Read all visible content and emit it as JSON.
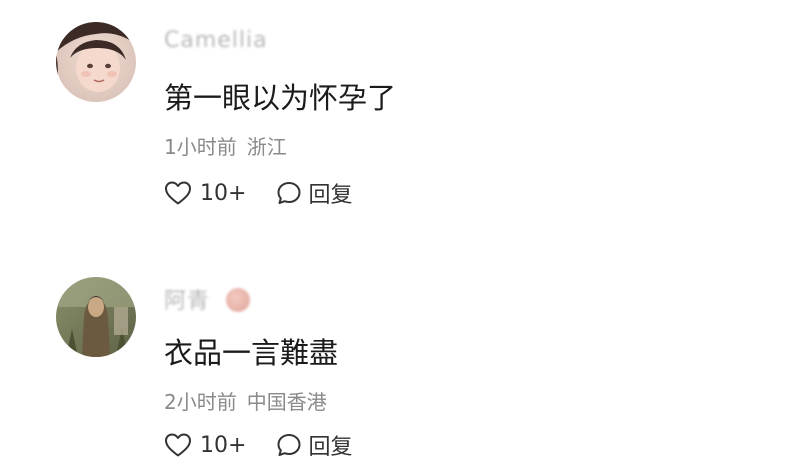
{
  "comments": [
    {
      "username": "Camellia",
      "content": "第一眼以为怀孕了",
      "time": "1小时前",
      "location": "浙江",
      "like_count": "10+",
      "reply_label": "回复",
      "like_icon": "heart-icon",
      "reply_icon": "speech-bubble-icon"
    },
    {
      "username": "阿青",
      "content": "衣品一言難盡",
      "time": "2小时前",
      "location": "中国香港",
      "like_count": "10+",
      "reply_label": "回复",
      "like_icon": "heart-icon",
      "reply_icon": "speech-bubble-icon"
    }
  ]
}
